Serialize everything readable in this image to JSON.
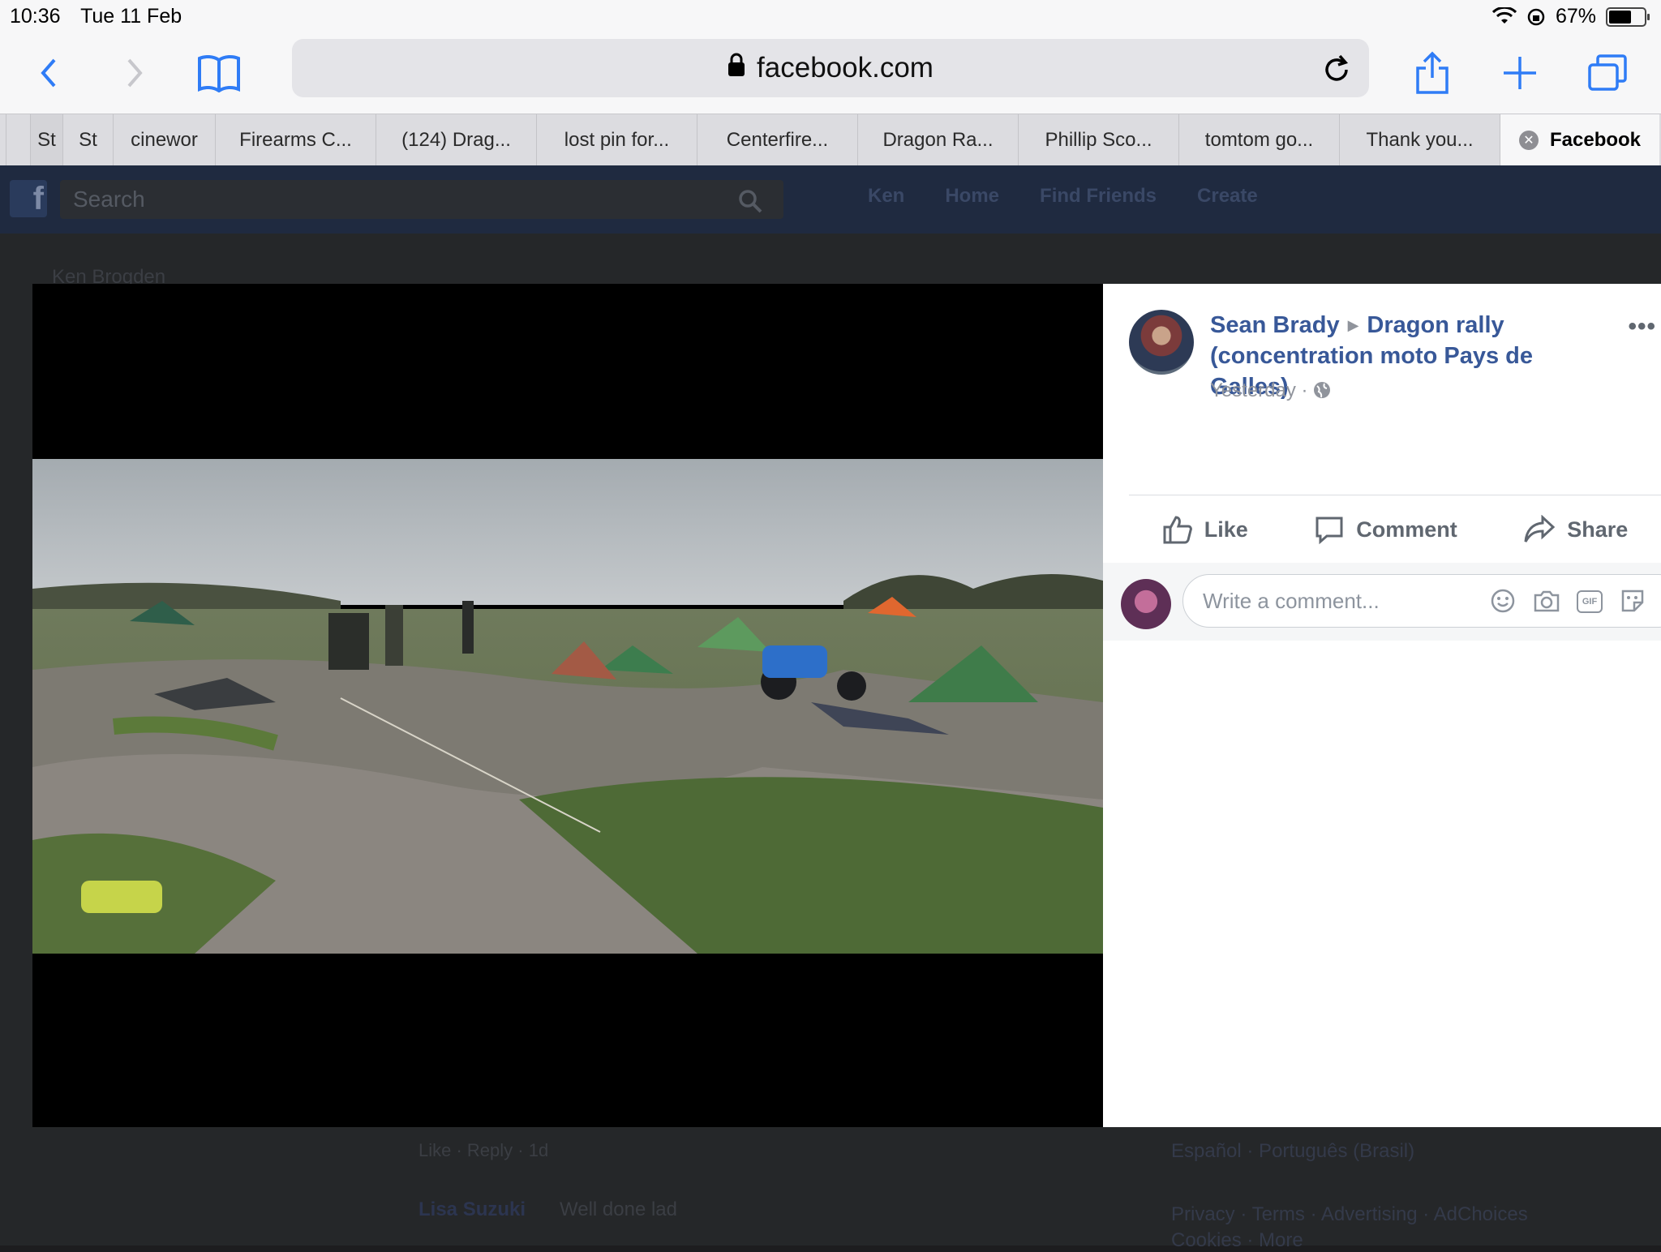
{
  "status_bar": {
    "time": "10:36",
    "date": "Tue 11 Feb",
    "battery": "67%",
    "battery_level": 0.67
  },
  "browser": {
    "url": "facebook.com"
  },
  "tabs": [
    {
      "label": ""
    },
    {
      "label": ""
    },
    {
      "label": "St"
    },
    {
      "label": "cinewor"
    },
    {
      "label": "Firearms C..."
    },
    {
      "label": "(124) Drag..."
    },
    {
      "label": "lost pin for..."
    },
    {
      "label": "Centerfire..."
    },
    {
      "label": "Dragon Ra..."
    },
    {
      "label": "Phillip Sco..."
    },
    {
      "label": "tomtom go..."
    },
    {
      "label": "Thank you..."
    },
    {
      "label": "Facebook",
      "active": true
    }
  ],
  "facebook": {
    "search_placeholder": "Search",
    "nav": {
      "user": "Ken",
      "home": "Home",
      "find_friends": "Find Friends",
      "create": "Create"
    },
    "left_user": "Ken Brogden",
    "bg_comment_meta": "Like · Reply · 1d",
    "bg_comment_author": "Lisa Suzuki",
    "bg_comment_text": "Well done lad",
    "bg_languages": "Español · Português (Brasil)",
    "bg_footer": "Privacy · Terms · Advertising · AdChoices",
    "bg_footer2": "Cookies · More"
  },
  "post": {
    "author": "Sean Brady",
    "group": "Dragon rally (concentration moto Pays de Galles)",
    "time": "Yesterday",
    "actions": {
      "like": "Like",
      "comment": "Comment",
      "share": "Share"
    },
    "comment_placeholder": "Write a comment...",
    "gif_label": "GIF"
  },
  "icons": [
    "back-icon",
    "forward-icon",
    "bookmarks-icon",
    "lock-icon",
    "reload-icon",
    "share-icon",
    "add-tab-icon",
    "tabs-icon",
    "wifi-icon",
    "rotation-lock-icon",
    "battery-icon",
    "search-icon",
    "like-icon",
    "comment-icon",
    "share-arrow-icon",
    "globe-icon",
    "emoji-icon",
    "camera-icon",
    "gif-icon",
    "sticker-icon",
    "more-icon"
  ]
}
